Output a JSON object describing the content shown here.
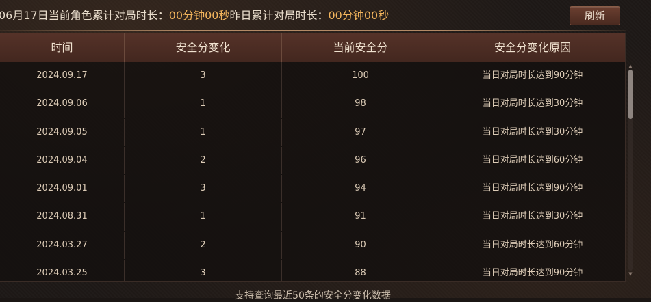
{
  "header": {
    "info_part1": "06月17日当前角色累计对局时长：",
    "info_value1": "00分钟00秒",
    "info_part2": "昨日累计对局时长：",
    "info_value2": "00分钟00秒",
    "refresh_label": "刷新"
  },
  "table": {
    "columns": [
      "时间",
      "安全分变化",
      "当前安全分",
      "安全分变化原因"
    ],
    "rows": [
      {
        "date": "2024.09.17",
        "change": "3",
        "score": "100",
        "reason": "当日对局时长达到90分钟"
      },
      {
        "date": "2024.09.06",
        "change": "1",
        "score": "98",
        "reason": "当日对局时长达到30分钟"
      },
      {
        "date": "2024.09.05",
        "change": "1",
        "score": "97",
        "reason": "当日对局时长达到30分钟"
      },
      {
        "date": "2024.09.04",
        "change": "2",
        "score": "96",
        "reason": "当日对局时长达到60分钟"
      },
      {
        "date": "2024.09.01",
        "change": "3",
        "score": "94",
        "reason": "当日对局时长达到90分钟"
      },
      {
        "date": "2024.08.31",
        "change": "1",
        "score": "91",
        "reason": "当日对局时长达到30分钟"
      },
      {
        "date": "2024.03.27",
        "change": "2",
        "score": "90",
        "reason": "当日对局时长达到60分钟"
      },
      {
        "date": "2024.03.25",
        "change": "3",
        "score": "88",
        "reason": "当日对局时长达到90分钟"
      }
    ]
  },
  "footer": {
    "note": "支持查询最近50条的安全分变化数据"
  },
  "icons": {
    "scroll_up": "scroll-up-arrow-icon",
    "scroll_down": "scroll-down-arrow-icon"
  },
  "colors": {
    "highlight": "#f2b45c",
    "header_bg": "#553228",
    "button_bg": "#6b3f30"
  }
}
